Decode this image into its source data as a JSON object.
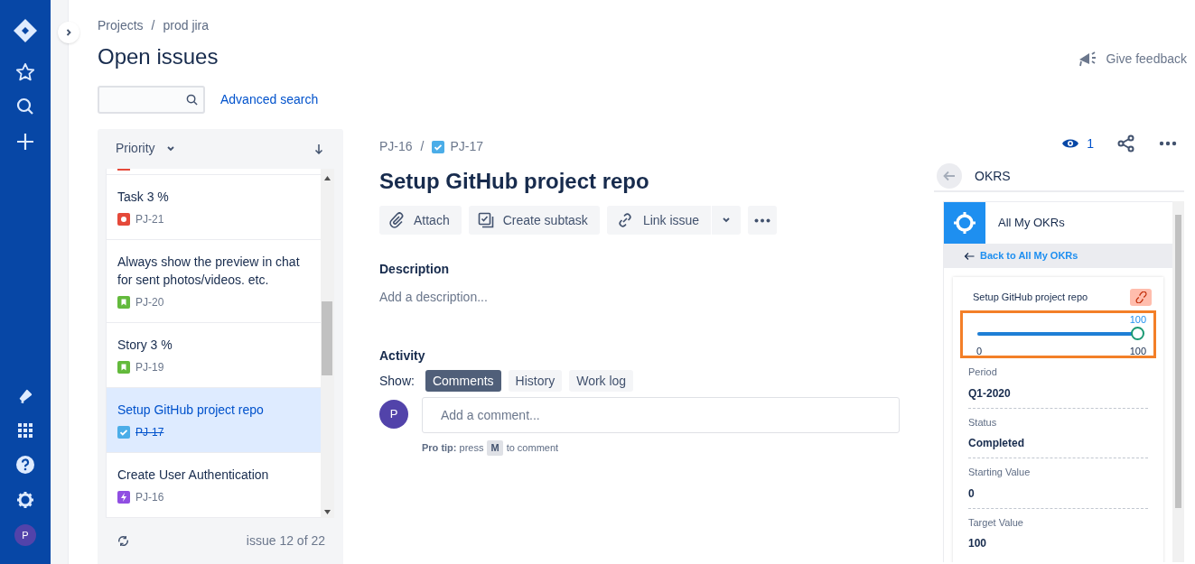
{
  "nav": {
    "avatar": "P"
  },
  "breadcrumbs": [
    "Projects",
    "prod jira"
  ],
  "breadcrumb_separator": "/",
  "page_title": "Open issues",
  "feedback": "Give feedback",
  "advanced_search": "Advanced search",
  "issue_list": {
    "sort_label": "Priority",
    "footer": "issue 12 of 22",
    "issues": [
      {
        "kind": "bug",
        "title": "Task 3 %",
        "key": "PJ-21",
        "selected": false,
        "resolved": false
      },
      {
        "kind": "story",
        "title": "Always show the preview in chat for sent photos/videos. etc.",
        "key": "PJ-20",
        "selected": false,
        "resolved": false
      },
      {
        "kind": "story",
        "title": "Story 3 %",
        "key": "PJ-19",
        "selected": false,
        "resolved": false
      },
      {
        "kind": "task",
        "title": "Setup GitHub project repo",
        "key": "PJ-17",
        "selected": true,
        "resolved": true
      },
      {
        "kind": "epic",
        "title": "Create User Authentication",
        "key": "PJ-16",
        "selected": false,
        "resolved": false
      }
    ]
  },
  "issue": {
    "parent_key": "PJ-16",
    "separator": "/",
    "key": "PJ-17",
    "title": "Setup GitHub project repo",
    "watchers": "1",
    "actions": [
      {
        "kind": "attach",
        "label": "Attach"
      },
      {
        "kind": "subtask",
        "label": "Create subtask"
      },
      {
        "kind": "link",
        "label": "Link issue"
      }
    ],
    "description_label": "Description",
    "description_placeholder": "Add a description...",
    "activity_label": "Activity",
    "show_label": "Show:",
    "activity_tabs": [
      {
        "label": "Comments",
        "selected": true
      },
      {
        "label": "History",
        "selected": false
      },
      {
        "label": "Work log",
        "selected": false
      }
    ],
    "comment_avatar": "P",
    "comment_placeholder": "Add a comment...",
    "pro_tip": "**Pro tip:** press",
    "pro_tip_key": "M",
    "pro_tip_end": "to comment"
  },
  "okrs": {
    "title": "OKRS",
    "app_title": "All My OKRs",
    "back_link": "Back to All My OKRs",
    "card_title": "Setup GitHub project repo",
    "progress": {
      "level": 1,
      "value": "100",
      "min": "0",
      "max": "100"
    },
    "fields": [
      {
        "label": "Period",
        "value": "Q1-2020"
      },
      {
        "label": "Status",
        "value": "Completed"
      },
      {
        "label": "Starting Value",
        "value": "0"
      },
      {
        "label": "Target Value",
        "value": "100"
      }
    ]
  }
}
